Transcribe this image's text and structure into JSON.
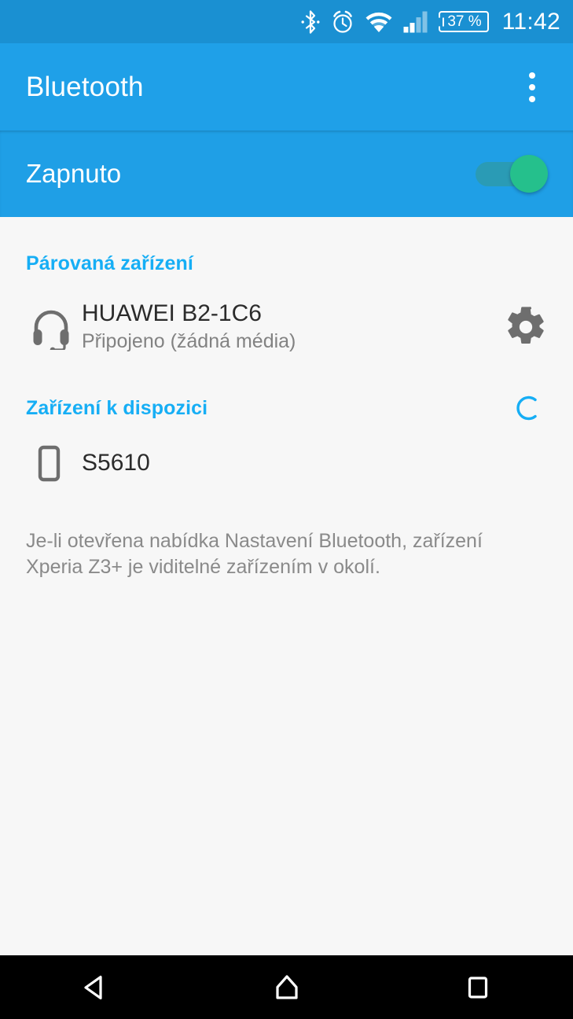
{
  "status_bar": {
    "icons": [
      "bluetooth-icon",
      "alarm-icon",
      "wifi-icon",
      "cellular-signal-icon"
    ],
    "battery_percent": "37 %",
    "clock": "11:42",
    "background_color": "#1a90d2"
  },
  "app_bar": {
    "title": "Bluetooth",
    "overflow_icon": "overflow-menu-icon",
    "background_color": "#1fa0e8"
  },
  "toggle": {
    "label": "Zapnuto",
    "state": "on",
    "thumb_color": "#25c08c",
    "track_color": "#2a9bb5"
  },
  "sections": {
    "paired": {
      "header": "Párovaná zařízení",
      "header_color": "#16aef5",
      "devices": [
        {
          "icon": "headset-icon",
          "name": "HUAWEI B2-1C6",
          "status": "Připojeno (žádná média)",
          "settings_icon": "gear-icon"
        }
      ]
    },
    "available": {
      "header": "Zařízení k dispozici",
      "header_color": "#16aef5",
      "scanning_icon": "loading-spinner-icon",
      "devices": [
        {
          "icon": "phone-icon",
          "name": "S5610"
        }
      ]
    }
  },
  "footer_note": "Je-li otevřena nabídka Nastavení Bluetooth, zařízení Xperia Z3+ je viditelné zařízením v okolí.",
  "nav_bar": {
    "back_icon": "back-triangle-icon",
    "home_icon": "home-icon",
    "recents_icon": "recents-square-icon",
    "background_color": "#000000"
  }
}
